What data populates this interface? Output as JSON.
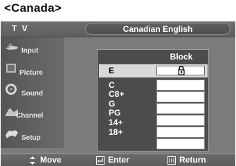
{
  "page_heading": "<Canada>",
  "header": {
    "tv_label": "T V",
    "title": "Canadian English"
  },
  "sidebar": {
    "items": [
      {
        "label": "Input",
        "icon": "input-icon"
      },
      {
        "label": "Picture",
        "icon": "picture-icon"
      },
      {
        "label": "Sound",
        "icon": "sound-icon"
      },
      {
        "label": "Channel",
        "icon": "channel-icon"
      },
      {
        "label": "Setup",
        "icon": "setup-icon"
      }
    ]
  },
  "panel": {
    "column_header": "Block",
    "selected_row": {
      "label": "E",
      "blocked": true,
      "icon": "lock-icon"
    },
    "ratings": [
      "C",
      "C8+",
      "G",
      "PG",
      "14+",
      "18+"
    ]
  },
  "footer": {
    "move_label": "Move",
    "enter_label": "Enter",
    "return_label": "Return"
  },
  "colors": {
    "screen_bg": "#7a7b7c",
    "panel_bg": "#4b4c4d",
    "selected_row_bg": "#d9d9d9"
  }
}
